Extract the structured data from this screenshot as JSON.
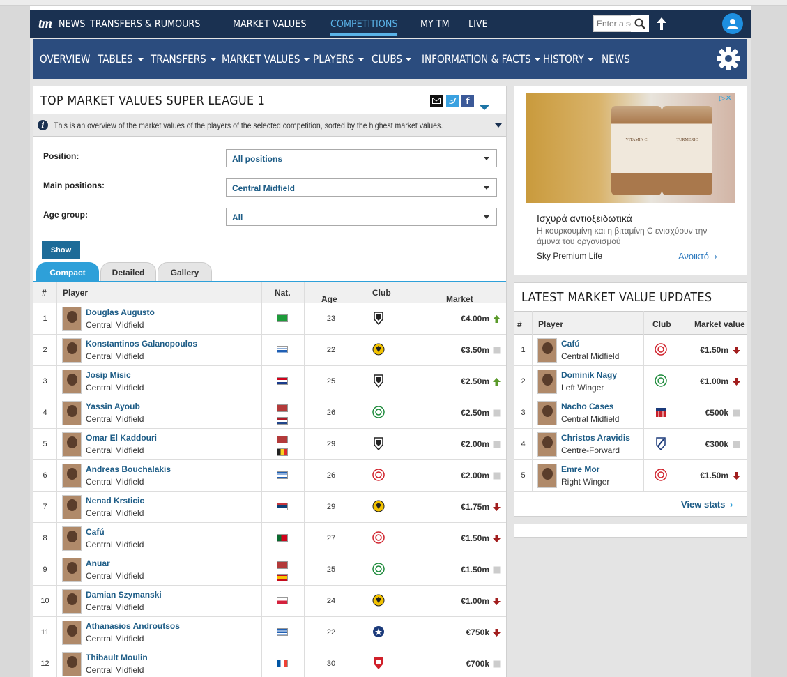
{
  "top_nav": {
    "logo": "tm",
    "items": [
      "NEWS",
      "TRANSFERS & RUMOURS",
      "MARKET VALUES",
      "COMPETITIONS",
      "MY TM",
      "LIVE"
    ],
    "active_index": 3,
    "search_placeholder": "Enter a se"
  },
  "sub_nav": {
    "items": [
      {
        "label": "OVERVIEW",
        "dropdown": false
      },
      {
        "label": "TABLES",
        "dropdown": true
      },
      {
        "label": "TRANSFERS",
        "dropdown": true
      },
      {
        "label": "MARKET VALUES",
        "dropdown": true
      },
      {
        "label": "PLAYERS",
        "dropdown": true
      },
      {
        "label": "CLUBS",
        "dropdown": true
      },
      {
        "label": "INFORMATION & FACTS",
        "dropdown": true
      },
      {
        "label": "HISTORY",
        "dropdown": true
      },
      {
        "label": "NEWS",
        "dropdown": false
      }
    ]
  },
  "main": {
    "title": "TOP MARKET VALUES SUPER LEAGUE 1",
    "info": "This is an overview of the market values of the players of the selected competition, sorted by the highest market values.",
    "filters": [
      {
        "label": "Position:",
        "value": "All positions"
      },
      {
        "label": "Main positions:",
        "value": "Central Midfield"
      },
      {
        "label": "Age group:",
        "value": "All"
      }
    ],
    "show_label": "Show",
    "tabs": [
      "Compact",
      "Detailed",
      "Gallery"
    ],
    "columns": {
      "num": "#",
      "player": "Player",
      "nat": "Nat.",
      "age": "Age",
      "club": "Club",
      "value": "Market value"
    },
    "rows": [
      {
        "num": "1",
        "name": "Douglas Augusto",
        "pos": "Central Midfield",
        "flags": [
          "brazil"
        ],
        "age": "23",
        "club": "paok",
        "value": "€4.00m",
        "trend": "up"
      },
      {
        "num": "2",
        "name": "Konstantinos Galanopoulos",
        "pos": "Central Midfield",
        "flags": [
          "greece"
        ],
        "age": "22",
        "club": "aek",
        "value": "€3.50m",
        "trend": "none"
      },
      {
        "num": "3",
        "name": "Josip Misic",
        "pos": "Central Midfield",
        "flags": [
          "croatia"
        ],
        "age": "25",
        "club": "paok",
        "value": "€2.50m",
        "trend": "up"
      },
      {
        "num": "4",
        "name": "Yassin Ayoub",
        "pos": "Central Midfield",
        "flags": [
          "morocco",
          "netherlands"
        ],
        "age": "26",
        "club": "panathinaikos",
        "value": "€2.50m",
        "trend": "none"
      },
      {
        "num": "5",
        "name": "Omar El Kaddouri",
        "pos": "Central Midfield",
        "flags": [
          "morocco",
          "belgium"
        ],
        "age": "29",
        "club": "paok",
        "value": "€2.00m",
        "trend": "none"
      },
      {
        "num": "6",
        "name": "Andreas Bouchalakis",
        "pos": "Central Midfield",
        "flags": [
          "greece"
        ],
        "age": "26",
        "club": "olympiacos",
        "value": "€2.00m",
        "trend": "none"
      },
      {
        "num": "7",
        "name": "Nenad Krsticic",
        "pos": "Central Midfield",
        "flags": [
          "serbia"
        ],
        "age": "29",
        "club": "aek",
        "value": "€1.75m",
        "trend": "down"
      },
      {
        "num": "8",
        "name": "Cafú",
        "pos": "Central Midfield",
        "flags": [
          "portugal"
        ],
        "age": "27",
        "club": "olympiacos",
        "value": "€1.50m",
        "trend": "down"
      },
      {
        "num": "9",
        "name": "Anuar",
        "pos": "Central Midfield",
        "flags": [
          "morocco",
          "spain"
        ],
        "age": "25",
        "club": "panathinaikos",
        "value": "€1.50m",
        "trend": "none"
      },
      {
        "num": "10",
        "name": "Damian Szymanski",
        "pos": "Central Midfield",
        "flags": [
          "poland"
        ],
        "age": "24",
        "club": "aek",
        "value": "€1.00m",
        "trend": "down"
      },
      {
        "num": "11",
        "name": "Athanasios Androutsos",
        "pos": "Central Midfield",
        "flags": [
          "greece"
        ],
        "age": "22",
        "club": "atromitos",
        "value": "€750k",
        "trend": "down"
      },
      {
        "num": "12",
        "name": "Thibault Moulin",
        "pos": "Central Midfield",
        "flags": [
          "france"
        ],
        "age": "30",
        "club": "xanthi",
        "value": "€700k",
        "trend": "none"
      }
    ]
  },
  "ad": {
    "jar_labels": [
      "VITAMIN C",
      "TURMERIC"
    ],
    "title": "Ισχυρά αντιοξειδωτικά",
    "text": "Η κουρκουμίνη και η βιταμίνη C ενισχύουν την άμυνα του οργανισμού",
    "source": "Sky Premium Life",
    "cta": "Ανοικτό"
  },
  "updates": {
    "title": "LATEST MARKET VALUE UPDATES",
    "columns": {
      "num": "#",
      "player": "Player",
      "club": "Club",
      "value": "Market value"
    },
    "rows": [
      {
        "num": "1",
        "name": "Cafú",
        "pos": "Central Midfield",
        "club": "olympiacos",
        "value": "€1.50m",
        "trend": "down"
      },
      {
        "num": "2",
        "name": "Dominik Nagy",
        "pos": "Left Winger",
        "club": "panathinaikos",
        "value": "€1.00m",
        "trend": "down"
      },
      {
        "num": "3",
        "name": "Nacho Cases",
        "pos": "Central Midfield",
        "club": "volos",
        "value": "€500k",
        "trend": "none"
      },
      {
        "num": "4",
        "name": "Christos Aravidis",
        "pos": "Centre-Forward",
        "club": "pas-giannina",
        "value": "€300k",
        "trend": "none"
      },
      {
        "num": "5",
        "name": "Emre Mor",
        "pos": "Right Winger",
        "club": "olympiacos",
        "value": "€1.50m",
        "trend": "down"
      }
    ],
    "view_stats": "View stats"
  },
  "colors": {
    "nav_dark": "#1a3151",
    "subnav": "#2b4c7e",
    "accent_blue": "#2ea0d9",
    "link": "#1d5c86",
    "trend_up": "#5a9a2a",
    "trend_down": "#a11d1d",
    "trend_none": "#cccccc"
  }
}
